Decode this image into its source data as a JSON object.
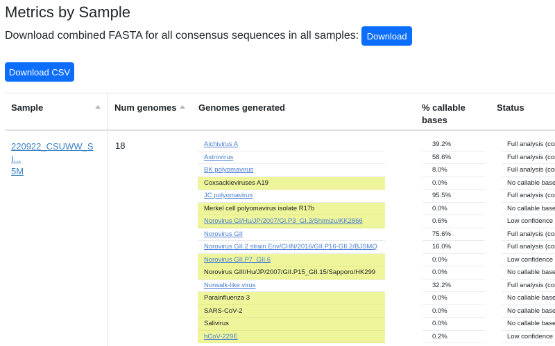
{
  "page": {
    "title": "Metrics by Sample",
    "fasta_text": "Download combined FASTA for all consensus sequences in all samples:",
    "download_label": "Download",
    "download_csv_label": "Download CSV"
  },
  "table": {
    "headers": {
      "sample": "Sample",
      "num_genomes": "Num genomes",
      "genomes_generated": "Genomes generated",
      "callable_line1": "% callable",
      "callable_line2": "bases",
      "status": "Status"
    },
    "rows": [
      {
        "sample": "220922_CSUWW_SI...",
        "sample_line2": "5M",
        "num_genomes": "18",
        "genomes": [
          {
            "name": "Aichivirus A",
            "link": true,
            "highlight": false,
            "pct": "39.2%",
            "status": "Full analysis (consensus)"
          },
          {
            "name": "Astrovirus",
            "link": true,
            "highlight": false,
            "pct": "58.6%",
            "status": "Full analysis (consensus)"
          },
          {
            "name": "BK polyomavirus",
            "link": true,
            "highlight": false,
            "pct": "8.0%",
            "status": "Full analysis (consensus)"
          },
          {
            "name": "Coxsackieviruses A19",
            "link": false,
            "highlight": true,
            "pct": "0.0%",
            "status": "No callable bases"
          },
          {
            "name": "JC polyomavirus",
            "link": true,
            "highlight": false,
            "pct": "95.5%",
            "status": "Full analysis (consensus)"
          },
          {
            "name": "Merkel cell polyomavirus isolate R17b",
            "link": false,
            "highlight": true,
            "pct": "0.0%",
            "status": "No callable bases"
          },
          {
            "name": "Norovirus GI/Hu/JP/2007/GI.P3_GI.3/Shimizu/KK2866",
            "link": true,
            "highlight": true,
            "pct": "0.6%",
            "status": "Low confidence"
          },
          {
            "name": "Norovirus GII",
            "link": true,
            "highlight": false,
            "pct": "75.6%",
            "status": "Full analysis (consensus)"
          },
          {
            "name": "Norovirus GII.2 strain Env/CHN/2016/GII.P16-GII.2/BJSMQ",
            "link": true,
            "highlight": false,
            "pct": "16.0%",
            "status": "Full analysis (consensus)"
          },
          {
            "name": "Norovirus GII.P7_GII.6",
            "link": true,
            "highlight": true,
            "pct": "0.0%",
            "status": "Low confidence"
          },
          {
            "name": "Norovirus GIII/Hu/JP/2007/GII.P15_GII.15/Sapporo/HK299",
            "link": false,
            "highlight": true,
            "pct": "0.0%",
            "status": "No callable bases"
          },
          {
            "name": "Norwalk-like virus",
            "link": true,
            "highlight": false,
            "pct": "32.2%",
            "status": "Full analysis (consensus)"
          },
          {
            "name": "Parainfluenza 3",
            "link": false,
            "highlight": true,
            "pct": "0.0%",
            "status": "No callable bases"
          },
          {
            "name": "SARS-CoV-2",
            "link": false,
            "highlight": true,
            "pct": "0.0%",
            "status": "No callable bases"
          },
          {
            "name": "Salivirus",
            "link": false,
            "highlight": true,
            "pct": "0.0%",
            "status": "No callable bases"
          },
          {
            "name": "hCoV-229E",
            "link": true,
            "highlight": true,
            "pct": "0.2%",
            "status": "Low confidence"
          }
        ]
      }
    ]
  },
  "colors": {
    "primary": "#0d6efd",
    "link": "#4a7fd4",
    "highlight": "#eef59a"
  }
}
